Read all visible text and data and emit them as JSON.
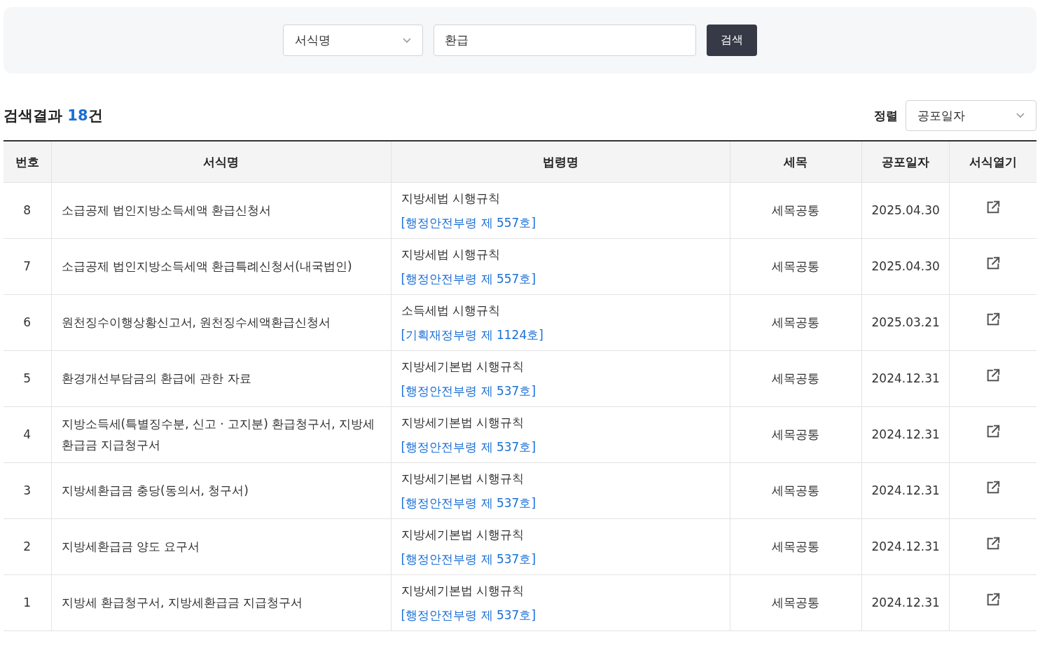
{
  "search": {
    "type_select": "서식명",
    "query": "환급",
    "button": "검색"
  },
  "results": {
    "label": "검색결과",
    "count": "18",
    "suffix": "건"
  },
  "sort": {
    "label": "정렬",
    "value": "공포일자"
  },
  "table": {
    "columns": [
      "번호",
      "서식명",
      "법령명",
      "세목",
      "공포일자",
      "서식열기"
    ],
    "rows": [
      {
        "no": "8",
        "form": "소급공제 법인지방소득세액 환급신청서",
        "law": "지방세법 시행규칙",
        "law_ref": "[행정안전부령 제 557호]",
        "tax": "세목공통",
        "date": "2025.04.30"
      },
      {
        "no": "7",
        "form": "소급공제 법인지방소득세액 환급특례신청서(내국법인)",
        "law": "지방세법 시행규칙",
        "law_ref": "[행정안전부령 제 557호]",
        "tax": "세목공통",
        "date": "2025.04.30"
      },
      {
        "no": "6",
        "form": "원천징수이행상황신고서, 원천징수세액환급신청서",
        "law": "소득세법 시행규칙",
        "law_ref": "[기획재정부령 제 1124호]",
        "tax": "세목공통",
        "date": "2025.03.21"
      },
      {
        "no": "5",
        "form": "환경개선부담금의 환급에 관한 자료",
        "law": "지방세기본법 시행규칙",
        "law_ref": "[행정안전부령 제 537호]",
        "tax": "세목공통",
        "date": "2024.12.31"
      },
      {
        "no": "4",
        "form": "지방소득세(특별징수분, 신고 · 고지분) 환급청구서, 지방세환급금 지급청구서",
        "law": "지방세기본법 시행규칙",
        "law_ref": "[행정안전부령 제 537호]",
        "tax": "세목공통",
        "date": "2024.12.31"
      },
      {
        "no": "3",
        "form": "지방세환급금 충당(동의서, 청구서)",
        "law": "지방세기본법 시행규칙",
        "law_ref": "[행정안전부령 제 537호]",
        "tax": "세목공통",
        "date": "2024.12.31"
      },
      {
        "no": "2",
        "form": "지방세환급금 양도 요구서",
        "law": "지방세기본법 시행규칙",
        "law_ref": "[행정안전부령 제 537호]",
        "tax": "세목공통",
        "date": "2024.12.31"
      },
      {
        "no": "1",
        "form": "지방세 환급청구서, 지방세환급금 지급청구서",
        "law": "지방세기본법 시행규칙",
        "law_ref": "[행정안전부령 제 537호]",
        "tax": "세목공통",
        "date": "2024.12.31"
      }
    ]
  }
}
